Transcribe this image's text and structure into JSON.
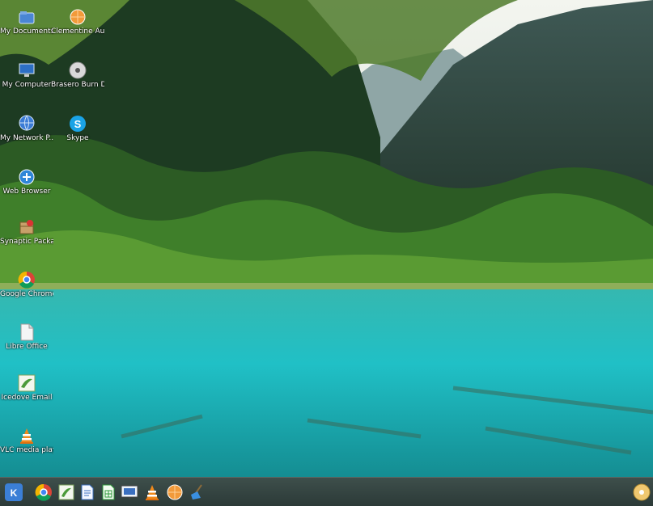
{
  "desktop": {
    "wallpaper": "mountain-lake-forest",
    "icons": [
      {
        "name": "my-documents",
        "label": "My Documents",
        "icon": "folder-icon"
      },
      {
        "name": "clementine",
        "label": "Clementine Audio Pl...",
        "icon": "orange-icon"
      },
      {
        "name": "my-computer",
        "label": "My Computer",
        "icon": "computer-icon"
      },
      {
        "name": "brasero",
        "label": "Brasero Burn DVDs",
        "icon": "disc-icon"
      },
      {
        "name": "my-network",
        "label": "My Network P...",
        "icon": "network-icon"
      },
      {
        "name": "skype",
        "label": "Skype",
        "icon": "skype-icon"
      },
      {
        "name": "web-browser",
        "label": "Web Browser",
        "icon": "browser-icon"
      },
      {
        "name": "synaptic",
        "label": "Synaptic Package ...",
        "icon": "package-icon"
      },
      {
        "name": "google-chrome",
        "label": "Google Chrome",
        "icon": "chrome-icon"
      },
      {
        "name": "libre-office",
        "label": "Libre Office",
        "icon": "document-icon"
      },
      {
        "name": "icedove",
        "label": "Icedove Email",
        "icon": "mail-icon"
      },
      {
        "name": "vlc",
        "label": "VLC media player",
        "icon": "vlc-icon"
      }
    ]
  },
  "taskbar": {
    "items": [
      {
        "name": "start-menu",
        "icon": "kde-start-icon"
      },
      {
        "name": "chrome",
        "icon": "chrome-icon"
      },
      {
        "name": "icedove",
        "icon": "mail-icon"
      },
      {
        "name": "writer",
        "icon": "writer-icon"
      },
      {
        "name": "calc",
        "icon": "calc-icon"
      },
      {
        "name": "impress",
        "icon": "impress-icon"
      },
      {
        "name": "vlc",
        "icon": "vlc-icon"
      },
      {
        "name": "clementine",
        "icon": "orange-icon"
      },
      {
        "name": "cleaner",
        "icon": "broom-icon"
      }
    ],
    "tray": {
      "icon": "disc-icon"
    }
  }
}
